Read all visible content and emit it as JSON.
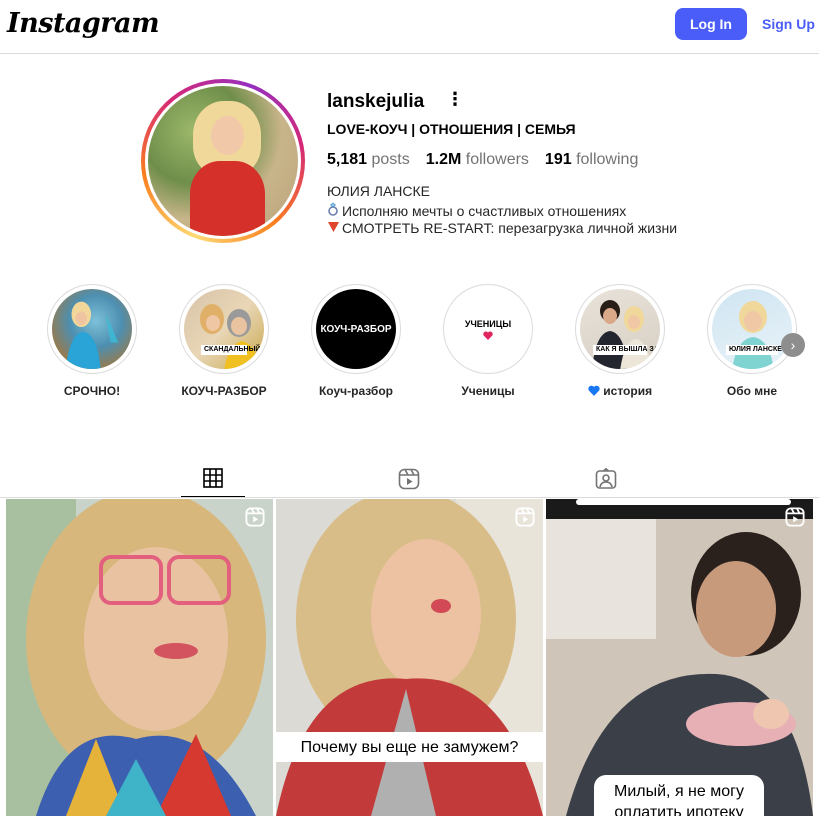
{
  "header": {
    "logo": "Instagram",
    "login_label": "Log In",
    "signup_label": "Sign Up"
  },
  "profile": {
    "username": "lanskejulia",
    "more_icon": "⋮",
    "headline": "LOVE-КОУЧ | ОТНОШЕНИЯ | СЕМЬЯ",
    "stats": {
      "posts_count": "5,181",
      "posts_label": "posts",
      "followers_count": "1.2M",
      "followers_label": "followers",
      "following_count": "191",
      "following_label": "following"
    },
    "full_name": "ЮЛИЯ ЛАНСКЕ",
    "bio_line1": "Исполняю мечты о счастливых отношениях",
    "bio_line2": "СМОТРЕТЬ RE-START: перезагрузка личной жизни"
  },
  "highlights": [
    {
      "label": "СРОЧНО!",
      "tag": ""
    },
    {
      "label": "КОУЧ-РАЗБОР",
      "tag": "СКАНДАЛЬНЫЙ РАЗВОД"
    },
    {
      "label": "Коуч-разбор",
      "tag": "КОУЧ-РАЗБОР"
    },
    {
      "label": "Ученицы",
      "tag": "УЧЕНИЦЫ"
    },
    {
      "label": "история",
      "tag": "КАК Я ВЫШЛА ЗАМУЖ"
    },
    {
      "label": "Обо мне",
      "tag": "ЮЛИЯ ЛАНСКЕ"
    }
  ],
  "tabs": [
    "grid-icon",
    "reels-icon",
    "tagged-icon"
  ],
  "posts": [
    {
      "caption": ""
    },
    {
      "caption": "Почему вы еще не замужем?"
    },
    {
      "caption_line1": "Милый, я не могу",
      "caption_line2": "оплатить ипотеку"
    }
  ],
  "colors": {
    "accent": "#4a5df9",
    "border": "#dbdbdb",
    "muted": "#737373"
  }
}
